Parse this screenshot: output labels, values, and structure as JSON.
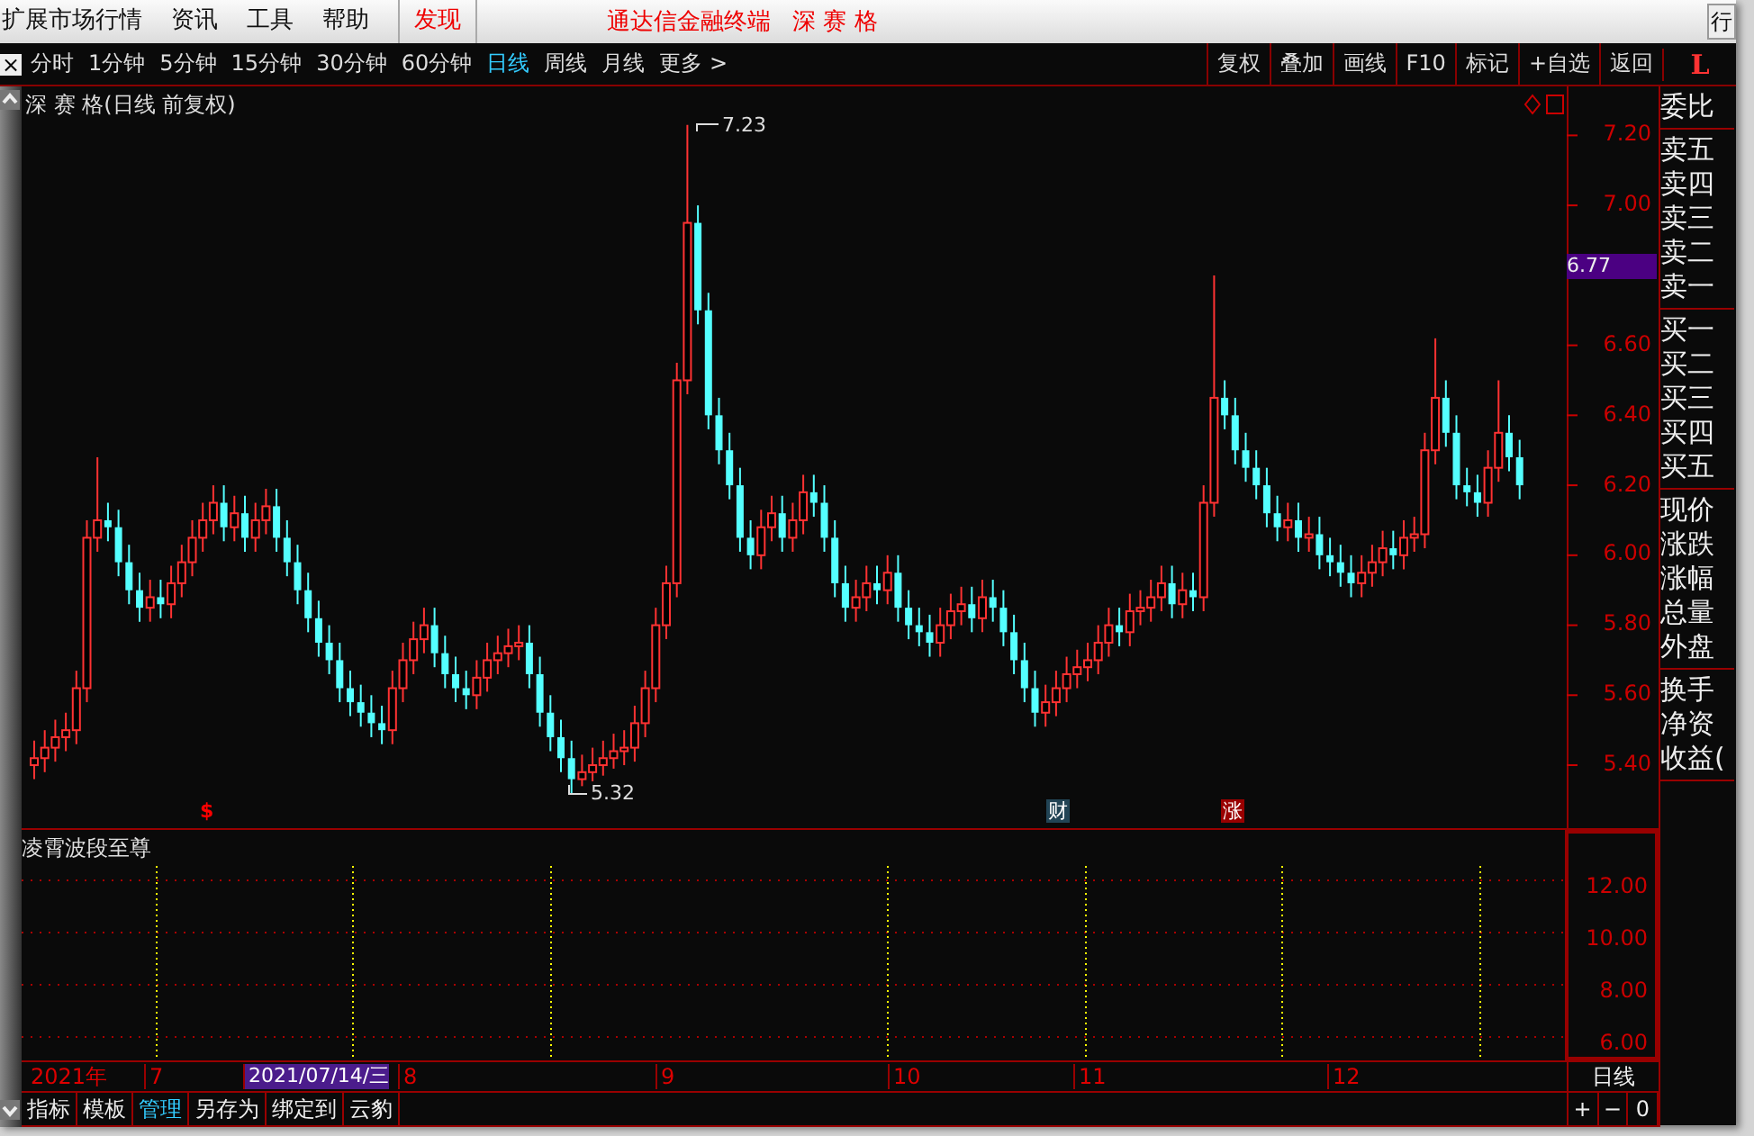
{
  "menu": [
    {
      "label": "扩展市场行情",
      "selected": false
    },
    {
      "label": "资讯",
      "selected": false
    },
    {
      "label": "工具",
      "selected": false
    },
    {
      "label": "帮助",
      "selected": false
    },
    {
      "label": "发现",
      "selected": true
    }
  ],
  "title_bar": {
    "app": "通达信金融终端",
    "stock": "深 赛 格",
    "corner_button": "行"
  },
  "close": "×",
  "periods": [
    {
      "label": "分时",
      "selected": false
    },
    {
      "label": "1分钟",
      "selected": false
    },
    {
      "label": "5分钟",
      "selected": false
    },
    {
      "label": "15分钟",
      "selected": false
    },
    {
      "label": "30分钟",
      "selected": false
    },
    {
      "label": "60分钟",
      "selected": false
    },
    {
      "label": "日线",
      "selected": true
    },
    {
      "label": "周线",
      "selected": false
    },
    {
      "label": "月线",
      "selected": false
    },
    {
      "label": "更多 >",
      "selected": false
    }
  ],
  "tools": [
    "复权",
    "叠加",
    "画线",
    "F10",
    "标记",
    "+自选",
    "返回"
  ],
  "panel_logo": "L",
  "chart": {
    "title": "深 赛 格(日线 前复权)",
    "high_label": "7.23",
    "low_label": "5.32",
    "current_price": "6.77",
    "markers": [
      {
        "text": "$",
        "kind": "dividend"
      },
      {
        "text": "财",
        "kind": "finance"
      },
      {
        "text": "涨",
        "kind": "limit"
      }
    ],
    "chart_data": {
      "type": "candlestick",
      "ylim": [
        5.22,
        7.34
      ],
      "yticks": [
        {
          "value": 7.2,
          "label": "7.20"
        },
        {
          "value": 7.0,
          "label": "7.00"
        },
        {
          "value": 6.6,
          "label": "6.60"
        },
        {
          "value": 6.4,
          "label": "6.40"
        },
        {
          "value": 6.2,
          "label": "6.20"
        },
        {
          "value": 6.0,
          "label": "6.00"
        },
        {
          "value": 5.8,
          "label": "5.80"
        },
        {
          "value": 5.6,
          "label": "5.60"
        },
        {
          "value": 5.4,
          "label": "5.40"
        }
      ],
      "ohlc": [
        [
          5.4,
          5.47,
          5.36,
          5.42
        ],
        [
          5.42,
          5.5,
          5.38,
          5.45
        ],
        [
          5.45,
          5.53,
          5.41,
          5.48
        ],
        [
          5.48,
          5.55,
          5.44,
          5.5
        ],
        [
          5.5,
          5.67,
          5.46,
          5.62
        ],
        [
          5.62,
          6.1,
          5.58,
          6.05
        ],
        [
          6.05,
          6.28,
          6.01,
          6.1
        ],
        [
          6.1,
          6.15,
          6.04,
          6.08
        ],
        [
          6.08,
          6.13,
          5.94,
          5.98
        ],
        [
          5.98,
          6.03,
          5.86,
          5.9
        ],
        [
          5.9,
          5.95,
          5.81,
          5.85
        ],
        [
          5.85,
          5.93,
          5.81,
          5.88
        ],
        [
          5.88,
          5.93,
          5.82,
          5.86
        ],
        [
          5.86,
          5.97,
          5.82,
          5.92
        ],
        [
          5.92,
          6.03,
          5.88,
          5.98
        ],
        [
          5.98,
          6.1,
          5.94,
          6.05
        ],
        [
          6.05,
          6.15,
          6.01,
          6.1
        ],
        [
          6.1,
          6.2,
          6.06,
          6.15
        ],
        [
          6.15,
          6.2,
          6.04,
          6.08
        ],
        [
          6.08,
          6.17,
          6.04,
          6.12
        ],
        [
          6.12,
          6.17,
          6.01,
          6.05
        ],
        [
          6.05,
          6.15,
          6.01,
          6.1
        ],
        [
          6.1,
          6.19,
          6.06,
          6.14
        ],
        [
          6.14,
          6.19,
          6.01,
          6.05
        ],
        [
          6.05,
          6.1,
          5.94,
          5.98
        ],
        [
          5.98,
          6.03,
          5.86,
          5.9
        ],
        [
          5.9,
          5.95,
          5.78,
          5.82
        ],
        [
          5.82,
          5.87,
          5.71,
          5.75
        ],
        [
          5.75,
          5.8,
          5.66,
          5.7
        ],
        [
          5.7,
          5.75,
          5.58,
          5.62
        ],
        [
          5.62,
          5.67,
          5.54,
          5.58
        ],
        [
          5.58,
          5.63,
          5.51,
          5.55
        ],
        [
          5.55,
          5.6,
          5.48,
          5.52
        ],
        [
          5.52,
          5.57,
          5.46,
          5.5
        ],
        [
          5.5,
          5.67,
          5.46,
          5.62
        ],
        [
          5.62,
          5.75,
          5.58,
          5.7
        ],
        [
          5.7,
          5.81,
          5.66,
          5.76
        ],
        [
          5.76,
          5.85,
          5.72,
          5.8
        ],
        [
          5.8,
          5.85,
          5.68,
          5.72
        ],
        [
          5.72,
          5.77,
          5.62,
          5.66
        ],
        [
          5.66,
          5.71,
          5.58,
          5.62
        ],
        [
          5.62,
          5.67,
          5.56,
          5.6
        ],
        [
          5.6,
          5.7,
          5.56,
          5.65
        ],
        [
          5.65,
          5.75,
          5.61,
          5.7
        ],
        [
          5.7,
          5.77,
          5.66,
          5.72
        ],
        [
          5.72,
          5.79,
          5.68,
          5.74
        ],
        [
          5.74,
          5.8,
          5.7,
          5.75
        ],
        [
          5.75,
          5.8,
          5.62,
          5.66
        ],
        [
          5.66,
          5.71,
          5.51,
          5.55
        ],
        [
          5.55,
          5.6,
          5.44,
          5.48
        ],
        [
          5.48,
          5.53,
          5.38,
          5.42
        ],
        [
          5.42,
          5.47,
          5.32,
          5.36
        ],
        [
          5.36,
          5.43,
          5.34,
          5.38
        ],
        [
          5.38,
          5.45,
          5.35,
          5.4
        ],
        [
          5.4,
          5.47,
          5.37,
          5.42
        ],
        [
          5.42,
          5.49,
          5.39,
          5.44
        ],
        [
          5.44,
          5.5,
          5.4,
          5.45
        ],
        [
          5.45,
          5.57,
          5.41,
          5.52
        ],
        [
          5.52,
          5.67,
          5.48,
          5.62
        ],
        [
          5.62,
          5.85,
          5.58,
          5.8
        ],
        [
          5.8,
          5.97,
          5.76,
          5.92
        ],
        [
          5.92,
          6.55,
          5.88,
          6.5
        ],
        [
          6.5,
          7.23,
          6.46,
          6.95
        ],
        [
          6.95,
          7.0,
          6.66,
          6.7
        ],
        [
          6.7,
          6.75,
          6.36,
          6.4
        ],
        [
          6.4,
          6.45,
          6.26,
          6.3
        ],
        [
          6.3,
          6.35,
          6.16,
          6.2
        ],
        [
          6.2,
          6.25,
          6.01,
          6.05
        ],
        [
          6.05,
          6.1,
          5.96,
          6.0
        ],
        [
          6.0,
          6.13,
          5.96,
          6.08
        ],
        [
          6.08,
          6.17,
          6.04,
          6.12
        ],
        [
          6.12,
          6.17,
          6.01,
          6.05
        ],
        [
          6.05,
          6.15,
          6.01,
          6.1
        ],
        [
          6.1,
          6.23,
          6.06,
          6.18
        ],
        [
          6.18,
          6.23,
          6.11,
          6.15
        ],
        [
          6.15,
          6.2,
          6.01,
          6.05
        ],
        [
          6.05,
          6.1,
          5.88,
          5.92
        ],
        [
          5.92,
          5.97,
          5.81,
          5.85
        ],
        [
          5.85,
          5.93,
          5.81,
          5.88
        ],
        [
          5.88,
          5.97,
          5.84,
          5.92
        ],
        [
          5.92,
          5.97,
          5.86,
          5.9
        ],
        [
          5.9,
          6.0,
          5.86,
          5.95
        ],
        [
          5.95,
          6.0,
          5.81,
          5.85
        ],
        [
          5.85,
          5.9,
          5.76,
          5.8
        ],
        [
          5.8,
          5.85,
          5.74,
          5.78
        ],
        [
          5.78,
          5.83,
          5.71,
          5.75
        ],
        [
          5.75,
          5.85,
          5.71,
          5.8
        ],
        [
          5.8,
          5.89,
          5.76,
          5.84
        ],
        [
          5.84,
          5.91,
          5.8,
          5.86
        ],
        [
          5.86,
          5.91,
          5.78,
          5.82
        ],
        [
          5.82,
          5.93,
          5.78,
          5.88
        ],
        [
          5.88,
          5.93,
          5.81,
          5.85
        ],
        [
          5.85,
          5.9,
          5.74,
          5.78
        ],
        [
          5.78,
          5.83,
          5.66,
          5.7
        ],
        [
          5.7,
          5.75,
          5.58,
          5.62
        ],
        [
          5.62,
          5.67,
          5.51,
          5.55
        ],
        [
          5.55,
          5.63,
          5.51,
          5.58
        ],
        [
          5.58,
          5.67,
          5.54,
          5.62
        ],
        [
          5.62,
          5.71,
          5.58,
          5.66
        ],
        [
          5.66,
          5.73,
          5.62,
          5.68
        ],
        [
          5.68,
          5.75,
          5.64,
          5.7
        ],
        [
          5.7,
          5.8,
          5.66,
          5.75
        ],
        [
          5.75,
          5.85,
          5.71,
          5.8
        ],
        [
          5.8,
          5.85,
          5.74,
          5.78
        ],
        [
          5.78,
          5.89,
          5.74,
          5.84
        ],
        [
          5.84,
          5.9,
          5.8,
          5.85
        ],
        [
          5.85,
          5.93,
          5.81,
          5.88
        ],
        [
          5.88,
          5.97,
          5.84,
          5.92
        ],
        [
          5.92,
          5.97,
          5.82,
          5.86
        ],
        [
          5.86,
          5.95,
          5.82,
          5.9
        ],
        [
          5.9,
          5.95,
          5.84,
          5.88
        ],
        [
          5.88,
          6.2,
          5.84,
          6.15
        ],
        [
          6.15,
          6.8,
          6.11,
          6.45
        ],
        [
          6.45,
          6.5,
          6.36,
          6.4
        ],
        [
          6.4,
          6.45,
          6.26,
          6.3
        ],
        [
          6.3,
          6.35,
          6.21,
          6.25
        ],
        [
          6.25,
          6.3,
          6.16,
          6.2
        ],
        [
          6.2,
          6.25,
          6.08,
          6.12
        ],
        [
          6.12,
          6.17,
          6.04,
          6.08
        ],
        [
          6.08,
          6.15,
          6.04,
          6.1
        ],
        [
          6.1,
          6.15,
          6.01,
          6.05
        ],
        [
          6.05,
          6.11,
          6.01,
          6.06
        ],
        [
          6.06,
          6.11,
          5.96,
          6.0
        ],
        [
          6.0,
          6.05,
          5.94,
          5.98
        ],
        [
          5.98,
          6.03,
          5.91,
          5.95
        ],
        [
          5.95,
          6.0,
          5.88,
          5.92
        ],
        [
          5.92,
          6.0,
          5.88,
          5.95
        ],
        [
          5.95,
          6.03,
          5.91,
          5.98
        ],
        [
          5.98,
          6.07,
          5.94,
          6.02
        ],
        [
          6.02,
          6.07,
          5.96,
          6.0
        ],
        [
          6.0,
          6.1,
          5.96,
          6.05
        ],
        [
          6.05,
          6.11,
          6.01,
          6.06
        ],
        [
          6.06,
          6.35,
          6.02,
          6.3
        ],
        [
          6.3,
          6.62,
          6.26,
          6.45
        ],
        [
          6.45,
          6.5,
          6.31,
          6.35
        ],
        [
          6.35,
          6.4,
          6.16,
          6.2
        ],
        [
          6.2,
          6.25,
          6.14,
          6.18
        ],
        [
          6.18,
          6.23,
          6.11,
          6.15
        ],
        [
          6.15,
          6.3,
          6.11,
          6.25
        ],
        [
          6.25,
          6.5,
          6.21,
          6.35
        ],
        [
          6.35,
          6.4,
          6.24,
          6.28
        ],
        [
          6.28,
          6.33,
          6.16,
          6.2
        ]
      ]
    }
  },
  "quote_panel": [
    [
      "委比"
    ],
    [
      "卖五",
      "卖四",
      "卖三",
      "卖二",
      "卖一"
    ],
    [
      "买一",
      "买二",
      "买三",
      "买四",
      "买五"
    ],
    [
      "现价",
      "涨跌",
      "涨幅",
      "总量",
      "外盘"
    ],
    [
      "换手",
      "净资",
      "收益("
    ]
  ],
  "indicator": {
    "title": "凌霄波段至尊",
    "yticks": [
      "12.00",
      "10.00",
      "8.00",
      "6.00"
    ]
  },
  "date_axis": [
    {
      "label": "2021年",
      "selected": false
    },
    {
      "label": "7",
      "selected": false
    },
    {
      "label": "2021/07/14/三",
      "selected": true
    },
    {
      "label": "8",
      "selected": false
    },
    {
      "label": "9",
      "selected": false
    },
    {
      "label": "10",
      "selected": false
    },
    {
      "label": "11",
      "selected": false
    },
    {
      "label": "12",
      "selected": false
    }
  ],
  "period_label": "日线",
  "bottom_tabs": [
    {
      "label": "指标",
      "selected": false
    },
    {
      "label": "模板",
      "selected": false
    },
    {
      "label": "管理",
      "selected": true
    },
    {
      "label": "另存为",
      "selected": false
    },
    {
      "label": "绑定到",
      "selected": false
    },
    {
      "label": "云豹",
      "selected": false
    }
  ],
  "zoom_buttons": [
    "+",
    "−",
    "0"
  ]
}
